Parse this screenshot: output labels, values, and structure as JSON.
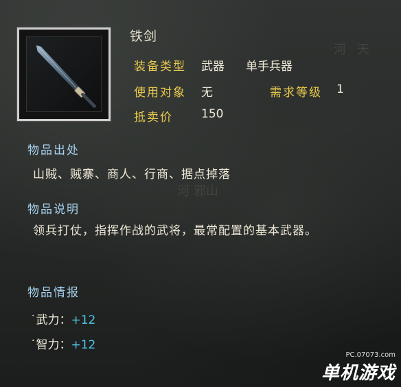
{
  "item": {
    "name": "铁剑",
    "icon": "iron-sword-icon"
  },
  "attrs": {
    "type_label": "装备类型",
    "type_value1": "武器",
    "type_value2": "单手兵器",
    "target_label": "使用对象",
    "target_value": "无",
    "level_label": "需求等级",
    "level_value": "1",
    "price_label": "抵卖价",
    "price_value": "150"
  },
  "source": {
    "heading": "物品出处",
    "text": "山贼、贼寨、商人、行商、据点掉落"
  },
  "description": {
    "heading": "物品说明",
    "text": "领兵打仗，指挥作战的武将，最常配置的基本武器。"
  },
  "info": {
    "heading": "物品情报",
    "stats": [
      {
        "name": "˙武力：",
        "value": "+12"
      },
      {
        "name": "˙智力：",
        "value": "+12"
      }
    ]
  },
  "background_marks": [
    "河",
    "天",
    "河",
    "邪山"
  ],
  "watermark": {
    "url": "PC.07073.com",
    "name": "单机游戏"
  }
}
